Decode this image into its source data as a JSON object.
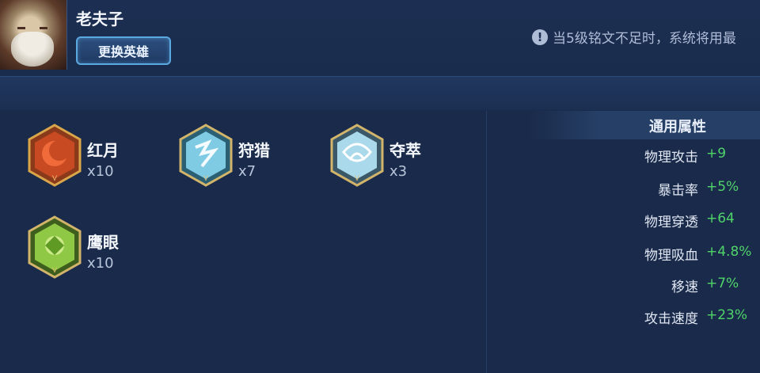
{
  "hero": {
    "name": "老夫子",
    "change_button": "更换英雄"
  },
  "notice": {
    "icon": "info-icon",
    "text": "当5级铭文不足时，系统将用最"
  },
  "runes": [
    {
      "name": "红月",
      "count": "x10",
      "color": "#d9532c",
      "icon": "red-moon-rune-icon"
    },
    {
      "name": "狩猎",
      "count": "x7",
      "color": "#5fb6d6",
      "icon": "hunt-rune-icon"
    },
    {
      "name": "夺萃",
      "count": "x3",
      "color": "#7fb7d2",
      "icon": "plunder-rune-icon"
    },
    {
      "name": "鹰眼",
      "count": "x10",
      "color": "#7ab83a",
      "icon": "hawk-eye-rune-icon"
    }
  ],
  "attributes": {
    "title": "通用属性",
    "items": [
      {
        "label": "物理攻击",
        "value": "+9"
      },
      {
        "label": "暴击率",
        "value": "+5%"
      },
      {
        "label": "物理穿透",
        "value": "+64"
      },
      {
        "label": "物理吸血",
        "value": "+4.8%"
      },
      {
        "label": "移速",
        "value": "+7%"
      },
      {
        "label": "攻击速度",
        "value": "+23%"
      }
    ]
  }
}
